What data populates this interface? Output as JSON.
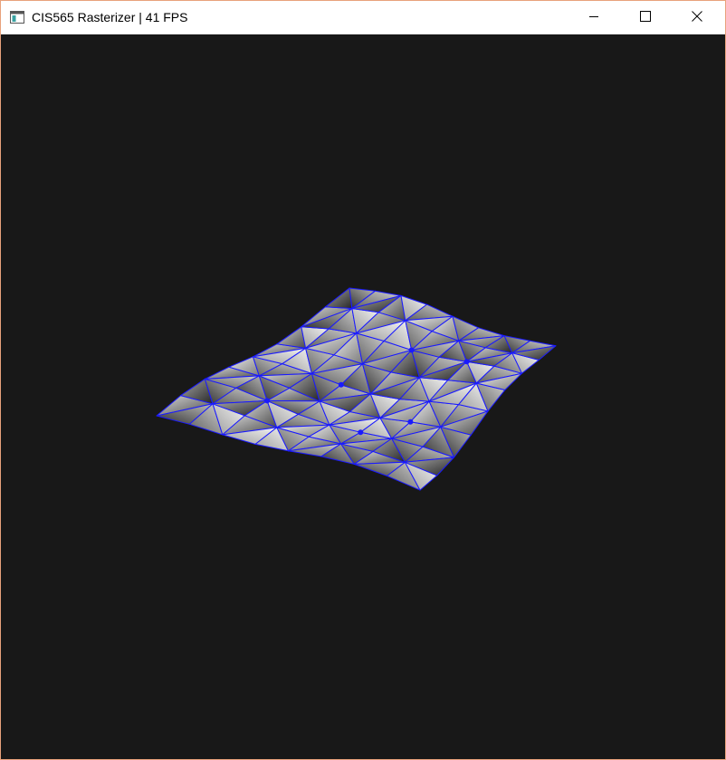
{
  "window": {
    "title": "CIS565 Rasterizer | 41 FPS",
    "icon": "app-window-icon",
    "controls": {
      "minimize_icon": "minimize-icon",
      "maximize_icon": "maximize-icon",
      "close_icon": "close-icon"
    },
    "border_color": "#e8a27c"
  },
  "viewport": {
    "background_color": "#181818",
    "wireframe_color": "#1a1aff",
    "scene": "shaded wavy triangle-mesh plane with blue wireframe edges"
  }
}
